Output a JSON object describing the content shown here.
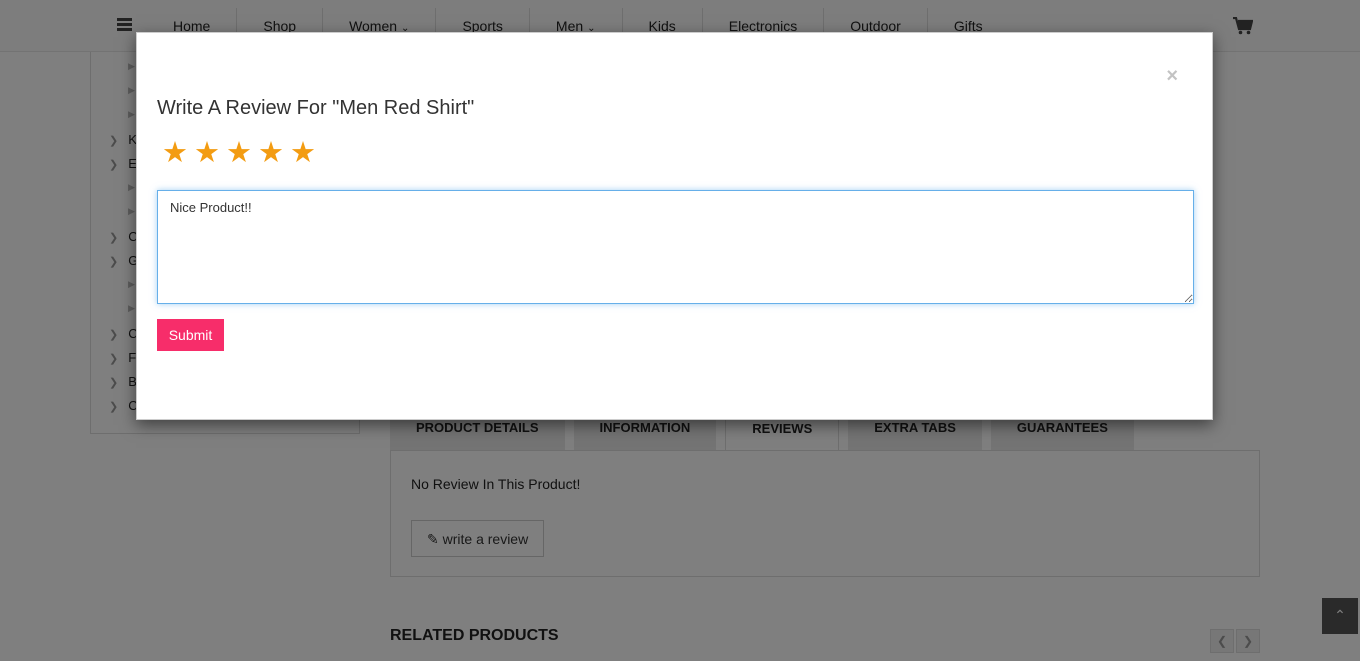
{
  "navbar": {
    "menu": [
      {
        "label": "Home"
      },
      {
        "label": "Shop"
      },
      {
        "label": "Women",
        "dropdown": true
      },
      {
        "label": "Sports"
      },
      {
        "label": "Men",
        "dropdown": true
      },
      {
        "label": "Kids"
      },
      {
        "label": "Electronics"
      },
      {
        "label": "Outdoor"
      },
      {
        "label": "Gifts"
      }
    ],
    "cart_icon": "shopping-cart-icon",
    "menu_icon": "hamburger-menu-icon"
  },
  "sidebar": {
    "letters": [
      "K",
      "E",
      "C",
      "G",
      "C",
      "F",
      "B",
      "C"
    ]
  },
  "product_tabs": {
    "tabs": [
      "PRODUCT DETAILS",
      "INFORMATION",
      "REVIEWS",
      "EXTRA TABS",
      "GUARANTEES"
    ],
    "active": "REVIEWS",
    "no_review_text": "No Review In This Product!",
    "write_review_label": "write a review",
    "write_review_icon": "pencil-icon"
  },
  "related": {
    "title": "RELATED PRODUCTS"
  },
  "modal": {
    "title": "Write A Review For \"Men Red Shirt\"",
    "close_symbol": "×",
    "rating": 5,
    "rating_max": 5,
    "star_color": "#f39c12",
    "review_text": "Nice Product!!",
    "submit_label": "Submit",
    "submit_color": "#f72d6a"
  }
}
